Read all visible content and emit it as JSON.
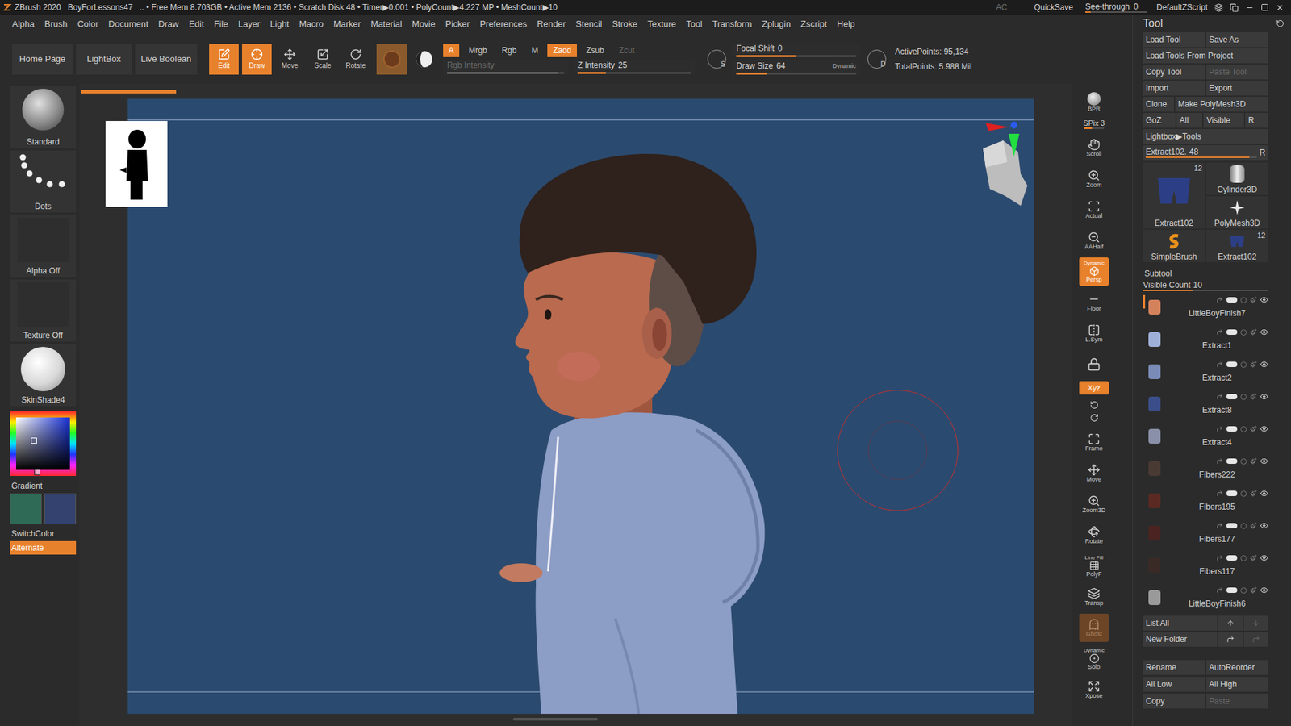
{
  "title_bar": {
    "app": "ZBrush 2020",
    "file": "BoyForLessons47",
    "stats": ".. • Free Mem 8.703GB • Active Mem 2136 • Scratch Disk 48 • Timer▶0.001 • PolyCount▶4.227 MP • MeshCount▶10",
    "ac": "AC",
    "quicksave": "QuickSave",
    "see_through": {
      "label": "See-through",
      "value": "0",
      "level": 0
    },
    "script": "DefaultZScript"
  },
  "menu": [
    "Alpha",
    "Brush",
    "Color",
    "Document",
    "Draw",
    "Edit",
    "File",
    "Layer",
    "Light",
    "Macro",
    "Marker",
    "Material",
    "Movie",
    "Picker",
    "Preferences",
    "Render",
    "Stencil",
    "Stroke",
    "Texture",
    "Tool",
    "Transform",
    "Zplugin",
    "Zscript",
    "Help"
  ],
  "shelf": {
    "home_buttons": [
      "Home Page",
      "LightBox",
      "Live Boolean"
    ],
    "modes": [
      {
        "label": "Edit",
        "selected": true
      },
      {
        "label": "Draw",
        "selected": true
      },
      {
        "label": "Move",
        "selected": false
      },
      {
        "label": "Scale",
        "selected": false
      },
      {
        "label": "Rotate",
        "selected": false
      }
    ],
    "channels": [
      {
        "label": "A",
        "selected": true,
        "disabled": false
      },
      {
        "label": "Mrgb",
        "selected": false,
        "disabled": false
      },
      {
        "label": "Rgb",
        "selected": false,
        "disabled": false
      },
      {
        "label": "M",
        "selected": false,
        "disabled": false
      },
      {
        "label": "Zadd",
        "selected": true,
        "disabled": false
      },
      {
        "label": "Zsub",
        "selected": false,
        "disabled": false
      },
      {
        "label": "Zcut",
        "selected": false,
        "disabled": true
      }
    ],
    "rgb_intensity": {
      "label": "Rgb Intensity",
      "value": "",
      "level": 0.95,
      "disabled": true
    },
    "z_intensity": {
      "label": "Z Intensity",
      "value": "25",
      "level": 0.25,
      "disabled": false
    },
    "focal_icon": "S",
    "draw_icon": "D",
    "focal_shift": {
      "label": "Focal Shift",
      "value": "0",
      "level": 0.5,
      "disabled": false
    },
    "draw_size": {
      "label": "Draw Size",
      "value": "64",
      "level": 0.25,
      "disabled": false,
      "badge": "Dynamic"
    },
    "stats": [
      "ActivePoints: 95,134",
      "TotalPoints: 5.988 Mil"
    ]
  },
  "left_shelf": {
    "items": [
      {
        "label": "Standard",
        "kind": "brush"
      },
      {
        "label": "Dots",
        "kind": "stroke"
      },
      {
        "label": "Alpha Off",
        "kind": "empty"
      },
      {
        "label": "Texture Off",
        "kind": "empty"
      },
      {
        "label": "SkinShade4",
        "kind": "material"
      }
    ],
    "gradient": "Gradient",
    "swatches": [
      {
        "color": "#2f6a56"
      },
      {
        "color": "#33426e"
      }
    ],
    "switch": "SwitchColor",
    "alternate": {
      "label": "Alternate",
      "selected": true
    }
  },
  "canvas": {
    "progress_level": 0.1
  },
  "right_shelf": [
    {
      "kind": "button",
      "label": "BPR",
      "selected": false,
      "disabled": false
    },
    {
      "kind": "slider",
      "label": "SPix 3",
      "level": 0.4
    },
    {
      "kind": "button",
      "label": "Scroll",
      "selected": false,
      "disabled": false
    },
    {
      "kind": "button",
      "label": "Zoom",
      "selected": false,
      "disabled": false
    },
    {
      "kind": "button",
      "label": "Actual",
      "selected": false,
      "disabled": false
    },
    {
      "kind": "button",
      "label": "AAHalf",
      "selected": false,
      "disabled": false
    },
    {
      "kind": "button",
      "label": "Persp",
      "top": "Dynamic",
      "selected": true,
      "disabled": false
    },
    {
      "kind": "button",
      "label": "Floor",
      "selected": false,
      "disabled": false
    },
    {
      "kind": "button",
      "label": "L.Sym",
      "selected": false,
      "disabled": false
    },
    {
      "kind": "icon",
      "selected": false
    },
    {
      "kind": "toggle",
      "label": "Xyz",
      "selected": true
    },
    {
      "kind": "icon",
      "selected": false
    },
    {
      "kind": "button",
      "label": "Frame",
      "selected": false,
      "disabled": false
    },
    {
      "kind": "button",
      "label": "Move",
      "selected": false,
      "disabled": false
    },
    {
      "kind": "button",
      "label": "Zoom3D",
      "selected": false,
      "disabled": false
    },
    {
      "kind": "button",
      "label": "Rotate",
      "selected": false,
      "disabled": false
    },
    {
      "kind": "button",
      "label": "PolyF",
      "top": "Line Fill",
      "selected": false,
      "disabled": false
    },
    {
      "kind": "button",
      "label": "Transp",
      "selected": false,
      "disabled": false
    },
    {
      "kind": "button",
      "label": "Ghost",
      "selected": true,
      "disabled": true
    },
    {
      "kind": "button",
      "label": "Solo",
      "top": "Dynamic",
      "selected": false,
      "disabled": false
    },
    {
      "kind": "button",
      "label": "Xpose",
      "selected": false,
      "disabled": false
    }
  ],
  "tool_panel": {
    "title": "Tool",
    "button_rows": [
      [
        {
          "label": "Load Tool",
          "disabled": false
        },
        {
          "label": "Save As",
          "disabled": false
        }
      ],
      [
        {
          "label": "Load Tools From Project",
          "disabled": false
        }
      ],
      [
        {
          "label": "Copy Tool",
          "disabled": false
        },
        {
          "label": "Paste Tool",
          "disabled": true
        }
      ],
      [
        {
          "label": "Import",
          "disabled": false
        },
        {
          "label": "Export",
          "disabled": false
        }
      ],
      [
        {
          "label": "Clone",
          "disabled": false
        },
        {
          "label": "Make PolyMesh3D",
          "disabled": false
        }
      ],
      [
        {
          "label": "GoZ",
          "disabled": false
        },
        {
          "label": "All",
          "disabled": false
        },
        {
          "label": "Visible",
          "disabled": false
        },
        {
          "label": "R",
          "disabled": false
        }
      ],
      [
        {
          "label": "Lightbox▶Tools",
          "disabled": false
        }
      ]
    ],
    "tool_slider": {
      "label": "Extract102.",
      "value": "48",
      "level": 0.93,
      "r": "R"
    },
    "tools": [
      {
        "label": "Extract102",
        "count": "12"
      },
      {
        "label": "Cylinder3D",
        "count": ""
      },
      {
        "label": "PolyMesh3D",
        "count": ""
      },
      {
        "label": "SimpleBrush",
        "count": ""
      },
      {
        "label": "Extract102",
        "count": "12"
      }
    ],
    "subtool": {
      "title": "Subtool",
      "visible_count": {
        "label": "Visible Count",
        "value": "10",
        "level": 0.4
      },
      "items": [
        {
          "name": "LittleBoyFinish7",
          "selected": true,
          "visible": true
        },
        {
          "name": "Extract1",
          "selected": false,
          "visible": true
        },
        {
          "name": "Extract2",
          "selected": false,
          "visible": true
        },
        {
          "name": "Extract8",
          "selected": false,
          "visible": true
        },
        {
          "name": "Extract4",
          "selected": false,
          "visible": true
        },
        {
          "name": "Fibers222",
          "selected": false,
          "visible": true
        },
        {
          "name": "Fibers195",
          "selected": false,
          "visible": true
        },
        {
          "name": "Fibers177",
          "selected": false,
          "visible": true
        },
        {
          "name": "Fibers117",
          "selected": false,
          "visible": true
        },
        {
          "name": "LittleBoyFinish6",
          "selected": false,
          "visible": true
        }
      ],
      "list_all": "List All",
      "new_folder": "New Folder",
      "pairs": [
        [
          {
            "label": "Rename",
            "disabled": false
          },
          {
            "label": "AutoReorder",
            "disabled": false
          }
        ],
        [
          {
            "label": "All Low",
            "disabled": false
          },
          {
            "label": "All High",
            "disabled": false
          }
        ],
        [
          {
            "label": "Copy",
            "disabled": false
          },
          {
            "label": "Paste",
            "disabled": true
          }
        ]
      ]
    }
  }
}
